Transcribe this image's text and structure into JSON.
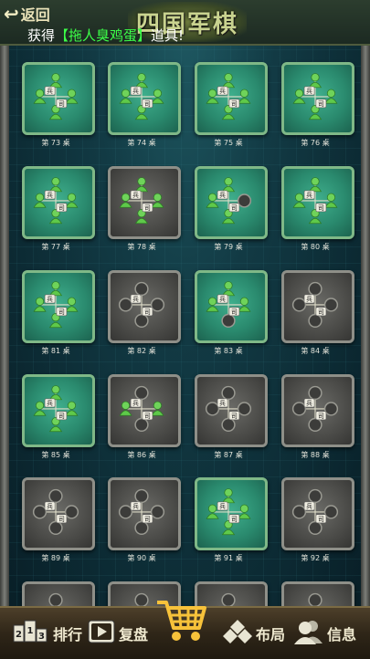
{
  "header": {
    "back_label": "返回",
    "logo_text": "四国军棋",
    "notice_prefix": "获得",
    "notice_item": "【拖人臭鸡蛋】",
    "notice_suffix": "道具!"
  },
  "table_piece_labels": {
    "soldier": "兵",
    "commander": "司"
  },
  "tables": [
    {
      "label": "第 73 桌",
      "occupied": true,
      "seats": [
        1,
        1,
        1,
        1
      ]
    },
    {
      "label": "第 74 桌",
      "occupied": true,
      "seats": [
        1,
        1,
        1,
        1
      ]
    },
    {
      "label": "第 75 桌",
      "occupied": true,
      "seats": [
        1,
        1,
        1,
        1
      ]
    },
    {
      "label": "第 76 桌",
      "occupied": true,
      "seats": [
        1,
        1,
        1,
        1
      ]
    },
    {
      "label": "第 77 桌",
      "occupied": true,
      "seats": [
        1,
        1,
        1,
        1
      ]
    },
    {
      "label": "第 78 桌",
      "occupied": false,
      "seats": [
        1,
        1,
        1,
        1
      ]
    },
    {
      "label": "第 79 桌",
      "occupied": true,
      "seats": [
        1,
        1,
        0,
        1
      ]
    },
    {
      "label": "第 80 桌",
      "occupied": true,
      "seats": [
        1,
        1,
        1,
        1
      ]
    },
    {
      "label": "第 81 桌",
      "occupied": true,
      "seats": [
        1,
        1,
        1,
        1
      ]
    },
    {
      "label": "第 82 桌",
      "occupied": false,
      "seats": [
        0,
        0,
        0,
        0
      ]
    },
    {
      "label": "第 83 桌",
      "occupied": true,
      "seats": [
        1,
        1,
        1,
        0
      ]
    },
    {
      "label": "第 84 桌",
      "occupied": false,
      "seats": [
        0,
        0,
        0,
        0
      ]
    },
    {
      "label": "第 85 桌",
      "occupied": true,
      "seats": [
        1,
        1,
        1,
        1
      ]
    },
    {
      "label": "第 86 桌",
      "occupied": false,
      "seats": [
        0,
        1,
        1,
        0
      ]
    },
    {
      "label": "第 87 桌",
      "occupied": false,
      "seats": [
        0,
        0,
        0,
        0
      ]
    },
    {
      "label": "第 88 桌",
      "occupied": false,
      "seats": [
        0,
        0,
        0,
        0
      ]
    },
    {
      "label": "第 89 桌",
      "occupied": false,
      "seats": [
        0,
        0,
        0,
        0
      ]
    },
    {
      "label": "第 90 桌",
      "occupied": false,
      "seats": [
        0,
        0,
        0,
        0
      ]
    },
    {
      "label": "第 91 桌",
      "occupied": true,
      "seats": [
        1,
        1,
        1,
        1
      ]
    },
    {
      "label": "第 92 桌",
      "occupied": false,
      "seats": [
        0,
        0,
        0,
        0
      ]
    },
    {
      "label": "",
      "occupied": false,
      "seats": [
        0,
        0,
        0,
        0
      ]
    },
    {
      "label": "",
      "occupied": false,
      "seats": [
        0,
        0,
        0,
        0
      ]
    },
    {
      "label": "",
      "occupied": false,
      "seats": [
        0,
        0,
        0,
        0
      ]
    },
    {
      "label": "",
      "occupied": false,
      "seats": [
        0,
        0,
        0,
        0
      ]
    }
  ],
  "bottom_bar": {
    "rank_label": "排行",
    "rank_badge": "213",
    "replay_label": "复盘",
    "layout_label": "布局",
    "info_label": "信息"
  },
  "colors": {
    "occupied_table": "#2a8a6e",
    "empty_table": "#4b4b48",
    "player_green": "#5fc94a",
    "notice_item": "#3cff48"
  }
}
